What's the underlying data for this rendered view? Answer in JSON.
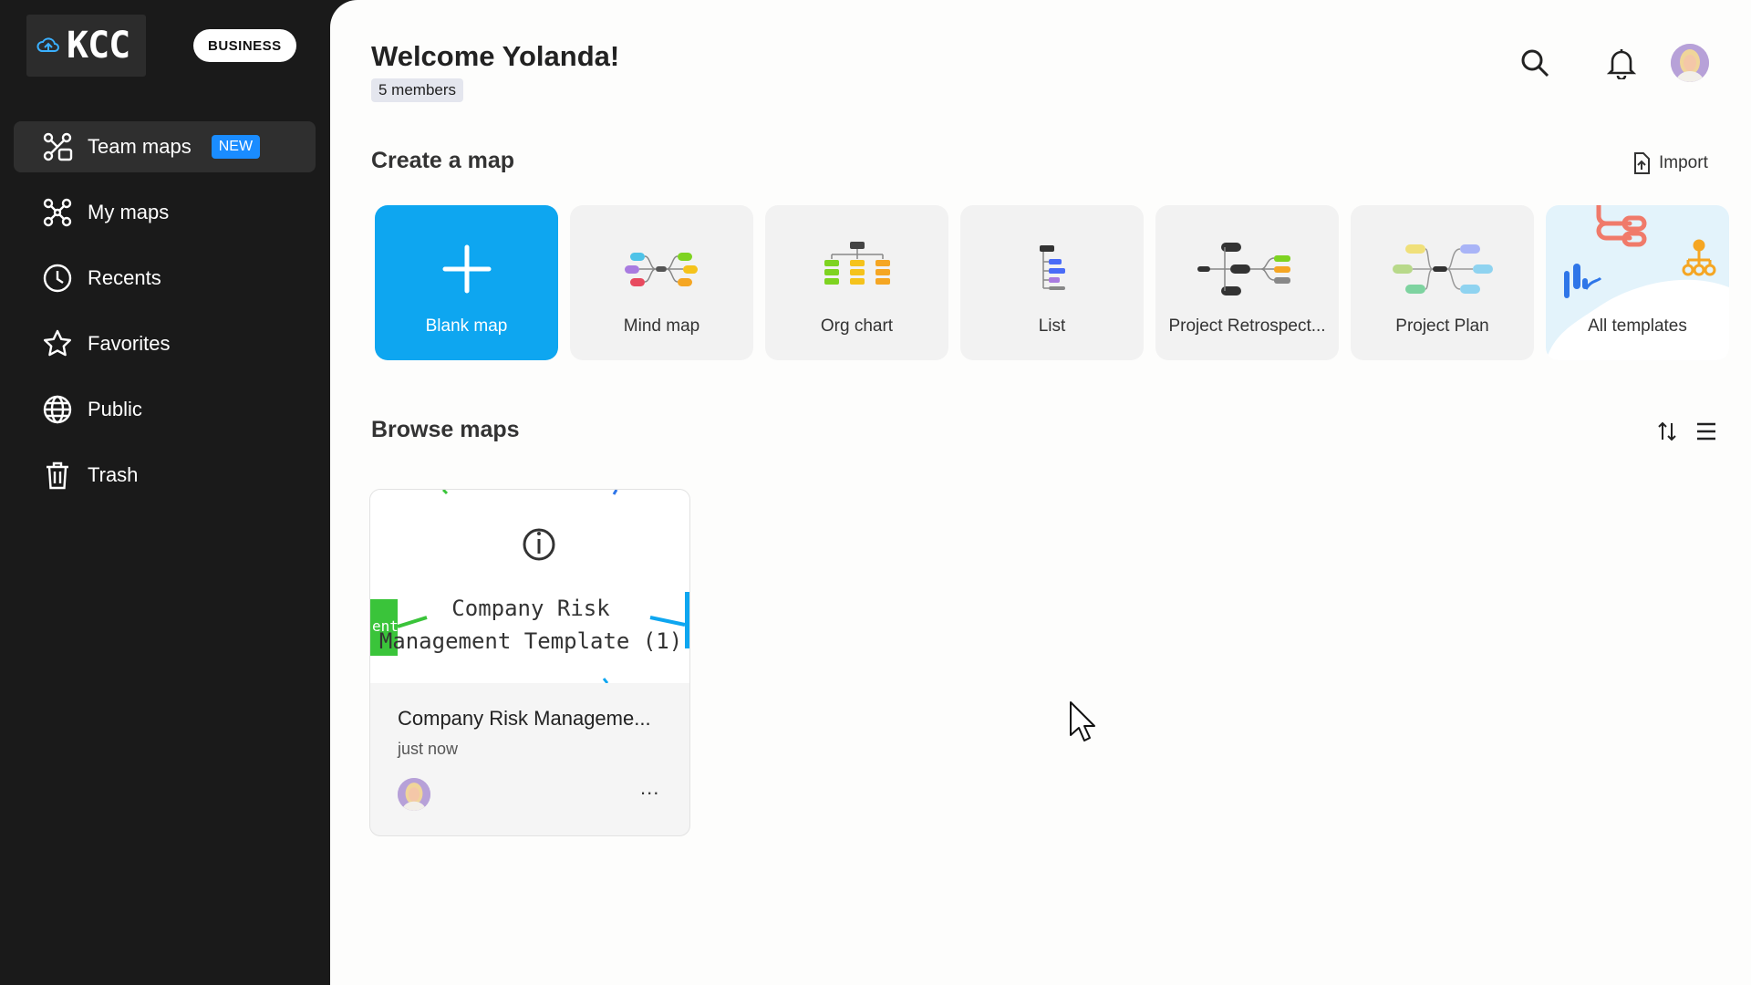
{
  "brand": {
    "logo_text": "KCC",
    "plan_badge": "BUSINESS"
  },
  "sidebar": {
    "items": [
      {
        "label": "Team maps",
        "badge": "NEW",
        "icon": "team-maps-icon",
        "active": true
      },
      {
        "label": "My maps",
        "icon": "my-maps-icon"
      },
      {
        "label": "Recents",
        "icon": "clock-icon"
      },
      {
        "label": "Favorites",
        "icon": "star-icon"
      },
      {
        "label": "Public",
        "icon": "globe-icon"
      },
      {
        "label": "Trash",
        "icon": "trash-icon"
      }
    ]
  },
  "header": {
    "welcome": "Welcome Yolanda!",
    "members": "5 members"
  },
  "create": {
    "title": "Create a map",
    "import_label": "Import",
    "templates": [
      {
        "label": "Blank map"
      },
      {
        "label": "Mind map"
      },
      {
        "label": "Org chart"
      },
      {
        "label": "List"
      },
      {
        "label": "Project Retrospect..."
      },
      {
        "label": "Project Plan"
      },
      {
        "label": "All templates"
      }
    ]
  },
  "browse": {
    "title": "Browse maps",
    "cards": [
      {
        "preview_line1": "Company Risk",
        "preview_line2": "Management Template (1)",
        "preview_side": "ent",
        "title": "Company Risk Manageme...",
        "time": "just now",
        "more": "..."
      }
    ]
  },
  "colors": {
    "accent": "#0ea6f0",
    "new_badge": "#1a8cff",
    "sidebar_bg": "#1a1a1a"
  }
}
